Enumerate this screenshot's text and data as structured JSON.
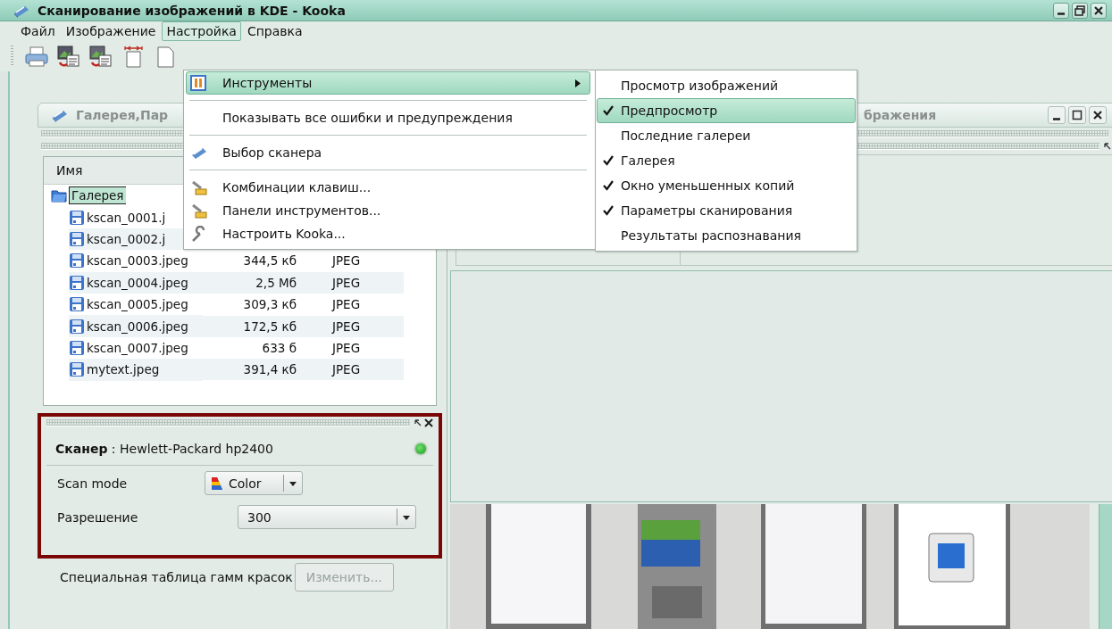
{
  "window": {
    "title": "Сканирование изображений в KDE - Kooka"
  },
  "menubar": [
    {
      "label": "Файл",
      "selected": false
    },
    {
      "label": "Изображение",
      "selected": false
    },
    {
      "label": "Настройка",
      "selected": true
    },
    {
      "label": "Справка",
      "selected": false
    }
  ],
  "settings_menu": [
    {
      "kind": "submenu",
      "label": "Инструменты",
      "selected": true
    },
    {
      "kind": "separator"
    },
    {
      "kind": "action",
      "label": "Показывать все ошибки и предупреждения",
      "selected": false
    },
    {
      "kind": "separator"
    },
    {
      "kind": "action",
      "label": "Выбор сканера",
      "selected": false
    },
    {
      "kind": "separator"
    },
    {
      "kind": "action",
      "label": "Комбинации клавиш...",
      "selected": false
    },
    {
      "kind": "action",
      "label": "Панели инструментов...",
      "selected": false
    },
    {
      "kind": "action",
      "label": "Настроить Kooka...",
      "selected": false
    }
  ],
  "tools_submenu": [
    {
      "label": "Просмотр изображений",
      "checked": false,
      "selected": false
    },
    {
      "label": "Предпросмотр",
      "checked": true,
      "selected": true
    },
    {
      "label": "Последние галереи",
      "checked": false,
      "selected": false
    },
    {
      "label": "Галерея",
      "checked": true,
      "selected": false
    },
    {
      "label": "Окно уменьшенных копий",
      "checked": true,
      "selected": false
    },
    {
      "label": "Параметры сканирования",
      "checked": true,
      "selected": false
    },
    {
      "label": "Результаты распознавания",
      "checked": false,
      "selected": false
    }
  ],
  "gallery_dock": {
    "title": "Галерея,Пар",
    "columns": [
      "Имя"
    ],
    "tree": {
      "label": "Галерея",
      "selected": true,
      "children": [
        {
          "name": "kscan_0001.j"
        },
        {
          "name": "kscan_0002.j"
        },
        {
          "name": "kscan_0003.jpeg",
          "size": "344,5 кб",
          "type": "JPEG"
        },
        {
          "name": "kscan_0004.jpeg",
          "size": "2,5 Мб",
          "type": "JPEG"
        },
        {
          "name": "kscan_0005.jpeg",
          "size": "309,3 кб",
          "type": "JPEG"
        },
        {
          "name": "kscan_0006.jpeg",
          "size": "172,5 кб",
          "type": "JPEG"
        },
        {
          "name": "kscan_0007.jpeg",
          "size": "633 б",
          "type": "JPEG"
        },
        {
          "name": "mytext.jpeg",
          "size": "391,4 кб",
          "type": "JPEG"
        }
      ]
    }
  },
  "scanner_panel": {
    "scanner": "**Сканер** : Hewlett-Packard hp2400",
    "online": true,
    "fields": [
      {
        "kind": "icon-combo",
        "label": "Scan mode",
        "value": "Color"
      },
      {
        "kind": "combo",
        "label": "Разрешение",
        "value": "300"
      }
    ]
  },
  "gamma": {
    "label": "Специальная таблица гамм красок",
    "button": "Изменить...",
    "disabled": true
  },
  "preview_dock": {
    "title": "бражения"
  }
}
